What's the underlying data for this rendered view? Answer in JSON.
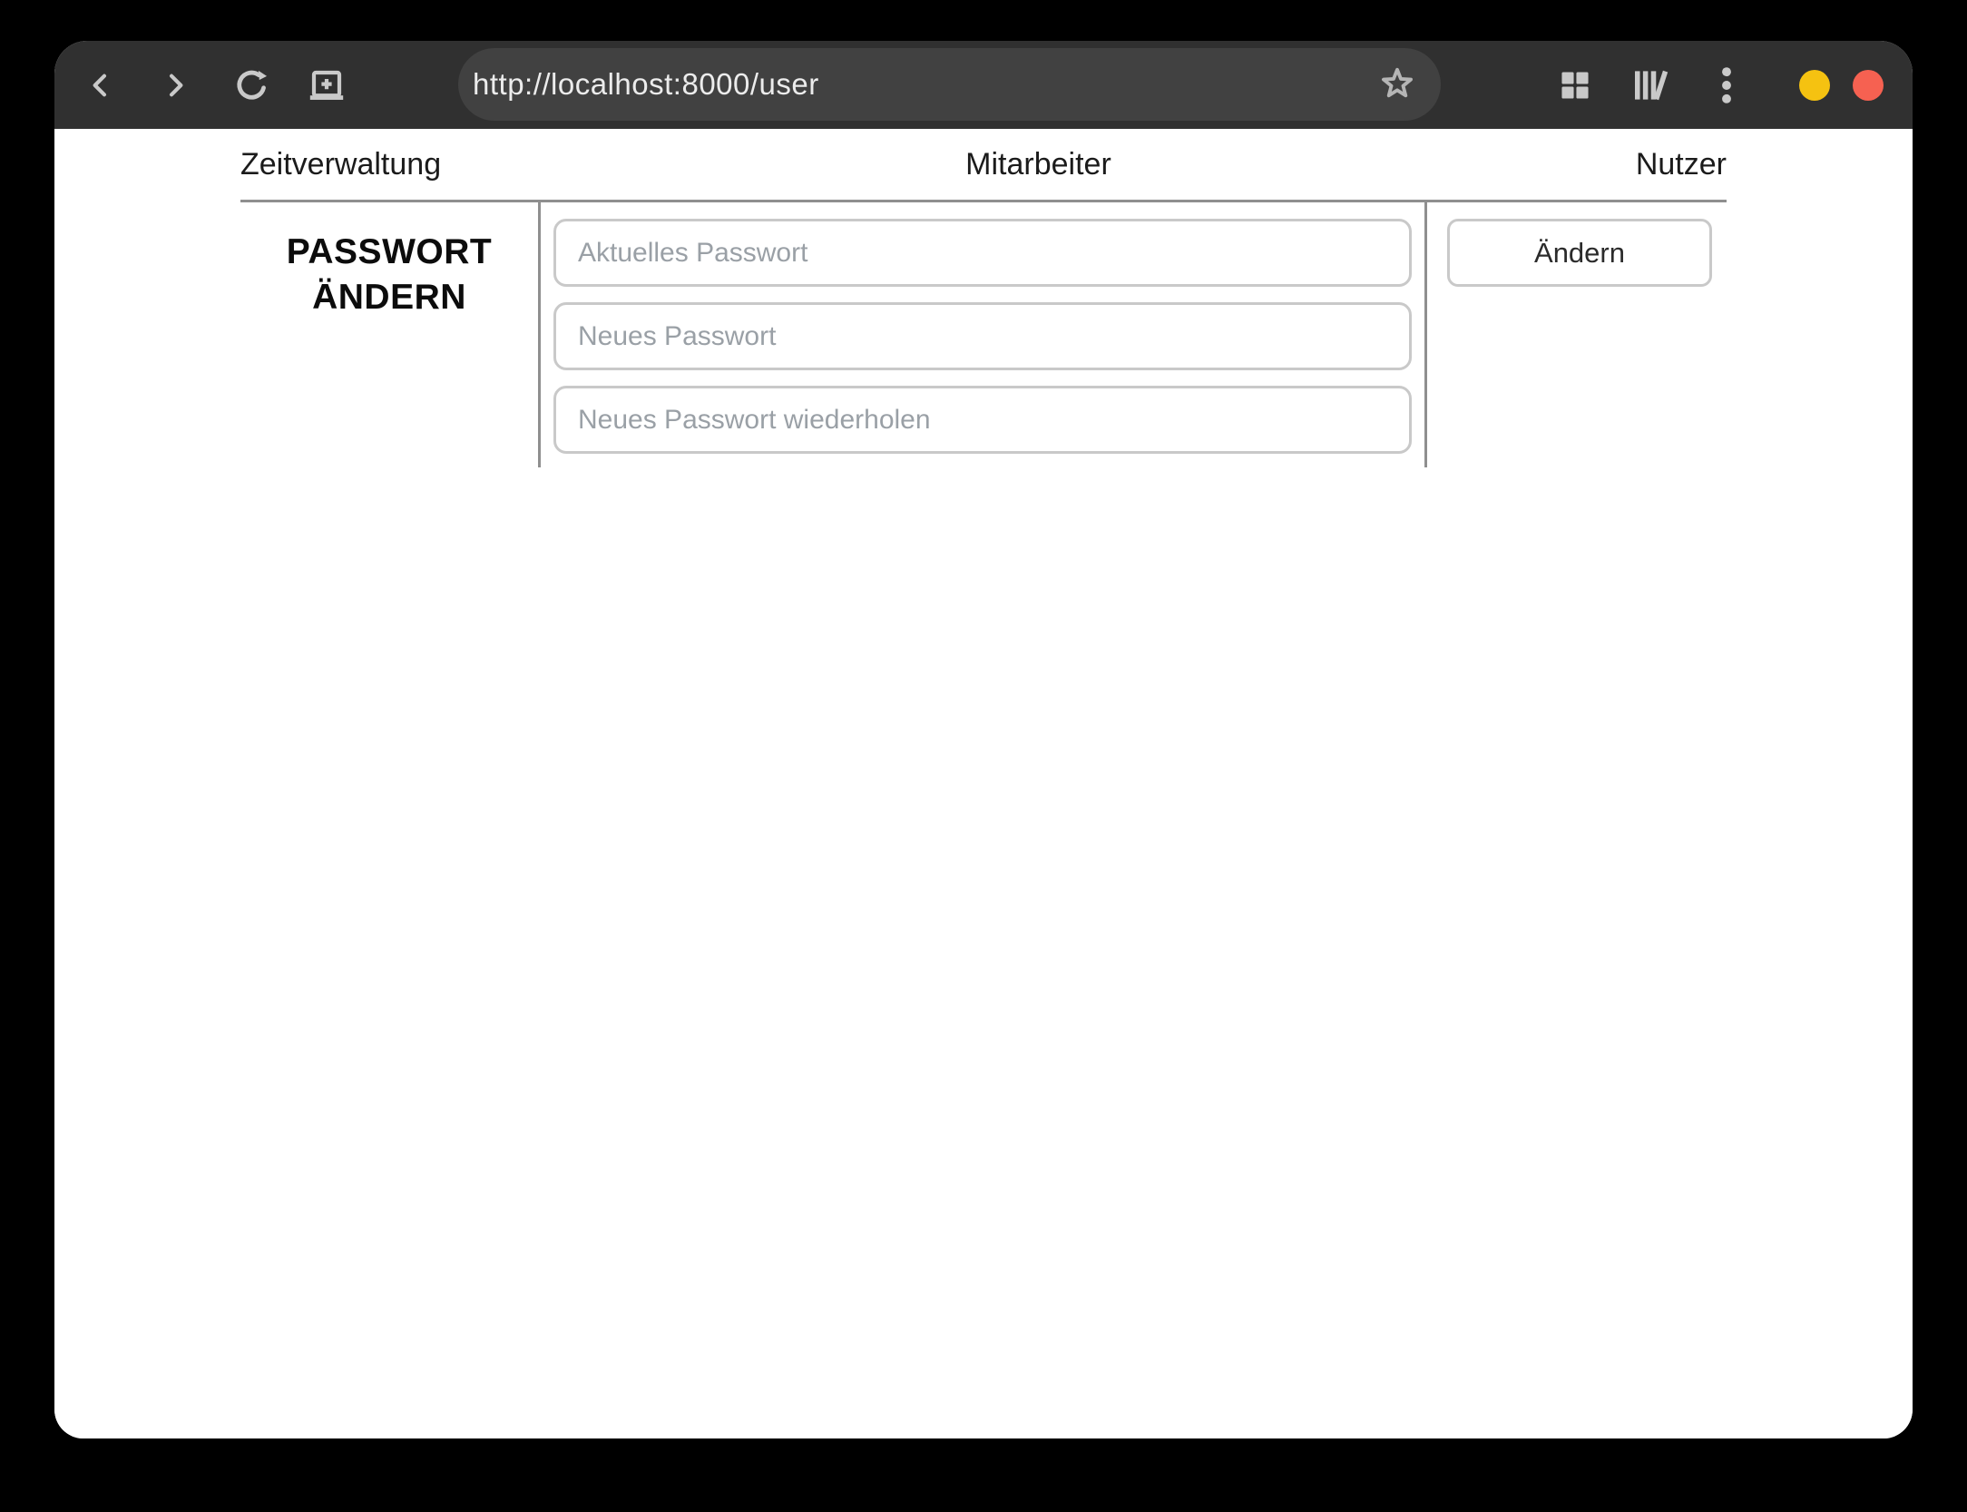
{
  "browser": {
    "url": "http://localhost:8000/user",
    "icons": [
      "back-icon",
      "forward-icon",
      "reload-icon",
      "new-window-icon",
      "bookmark-star-icon",
      "grid-icon",
      "library-icon",
      "kebab-menu-icon"
    ],
    "window_controls": [
      "minimize",
      "close"
    ]
  },
  "nav": {
    "items": [
      {
        "label": "Zeitverwaltung"
      },
      {
        "label": "Mitarbeiter"
      },
      {
        "label": "Nutzer"
      }
    ]
  },
  "form": {
    "heading_line1": "PASSWORT",
    "heading_line2": "ÄNDERN",
    "fields": [
      {
        "placeholder": "Aktuelles Passwort"
      },
      {
        "placeholder": "Neues Passwort"
      },
      {
        "placeholder": "Neues Passwort wiederholen"
      }
    ],
    "submit_label": "Ändern"
  },
  "colors": {
    "page_bg": "#000000",
    "titlebar": "#303030",
    "urlbar": "#414141",
    "icon": "#c9c9c9",
    "url_text": "#ececec",
    "minimize": "#f5c211",
    "close": "#f66151",
    "rule": "#8f8f8f",
    "input_border": "#c9c9c9",
    "placeholder": "#9aa0a6",
    "text": "#1b1b1b"
  }
}
